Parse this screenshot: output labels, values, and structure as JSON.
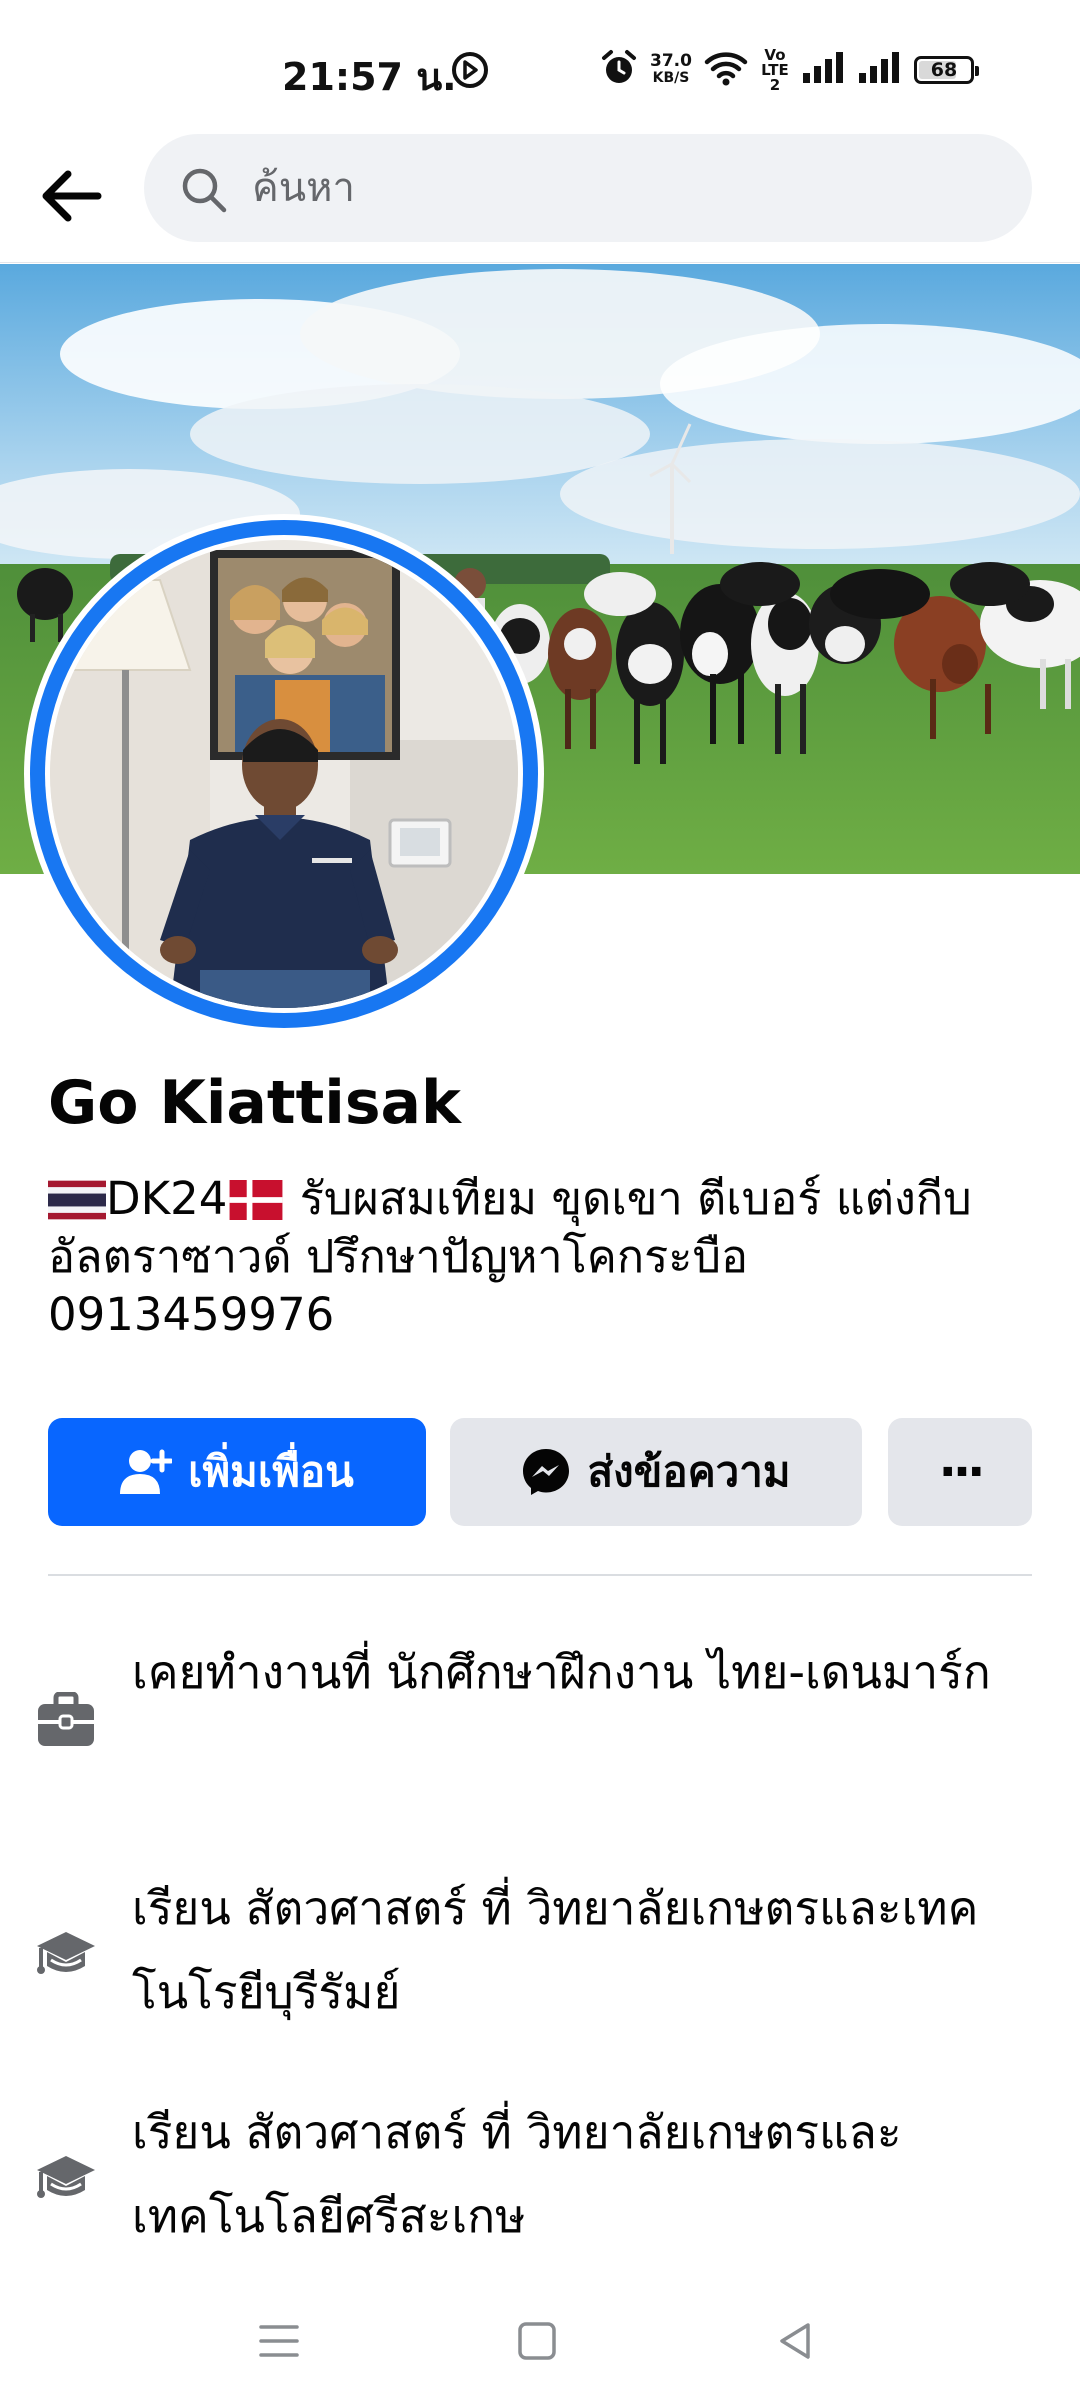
{
  "status_bar": {
    "time": "21:57 น.",
    "net_speed_value": "37.0",
    "net_speed_unit": "KB/S",
    "volte": "Vo LTE2",
    "battery": "68"
  },
  "search": {
    "placeholder": "ค้นหา"
  },
  "profile": {
    "name": "Go Kiattisak",
    "bio_prefix": "DK24",
    "bio_text": " รับผสมเทียม ขุดเขา ตีเบอร์ แต่งกีบ อัลตราซาวด์ ปรึกษาปัญหาโคกระบือ",
    "phone": "0913459976"
  },
  "actions": {
    "add_friend_label": "เพิ่มเพื่อน",
    "message_label": "ส่งข้อความ",
    "more_label": "···"
  },
  "info": [
    {
      "icon": "briefcase-icon",
      "text": "เคยทำงานที่ นักศึกษาฝึกงาน ไทย-เดนมาร์ก"
    },
    {
      "icon": "graduation-cap-icon",
      "text": "เรียน สัตวศาสตร์ ที่ วิทยาลัยเกษตรและเทคโนโรยีบุรีรัมย์"
    },
    {
      "icon": "graduation-cap-icon",
      "text": "เรียน สัตวศาสตร์ ที่ วิทยาลัยเกษตรและเทคโนโลยีศรีสะเกษ"
    }
  ],
  "colors": {
    "primary_blue": "#0866ff",
    "secondary_button": "#e4e6eb",
    "search_bg": "#f0f2f5",
    "avatar_ring": "#1877f2"
  }
}
